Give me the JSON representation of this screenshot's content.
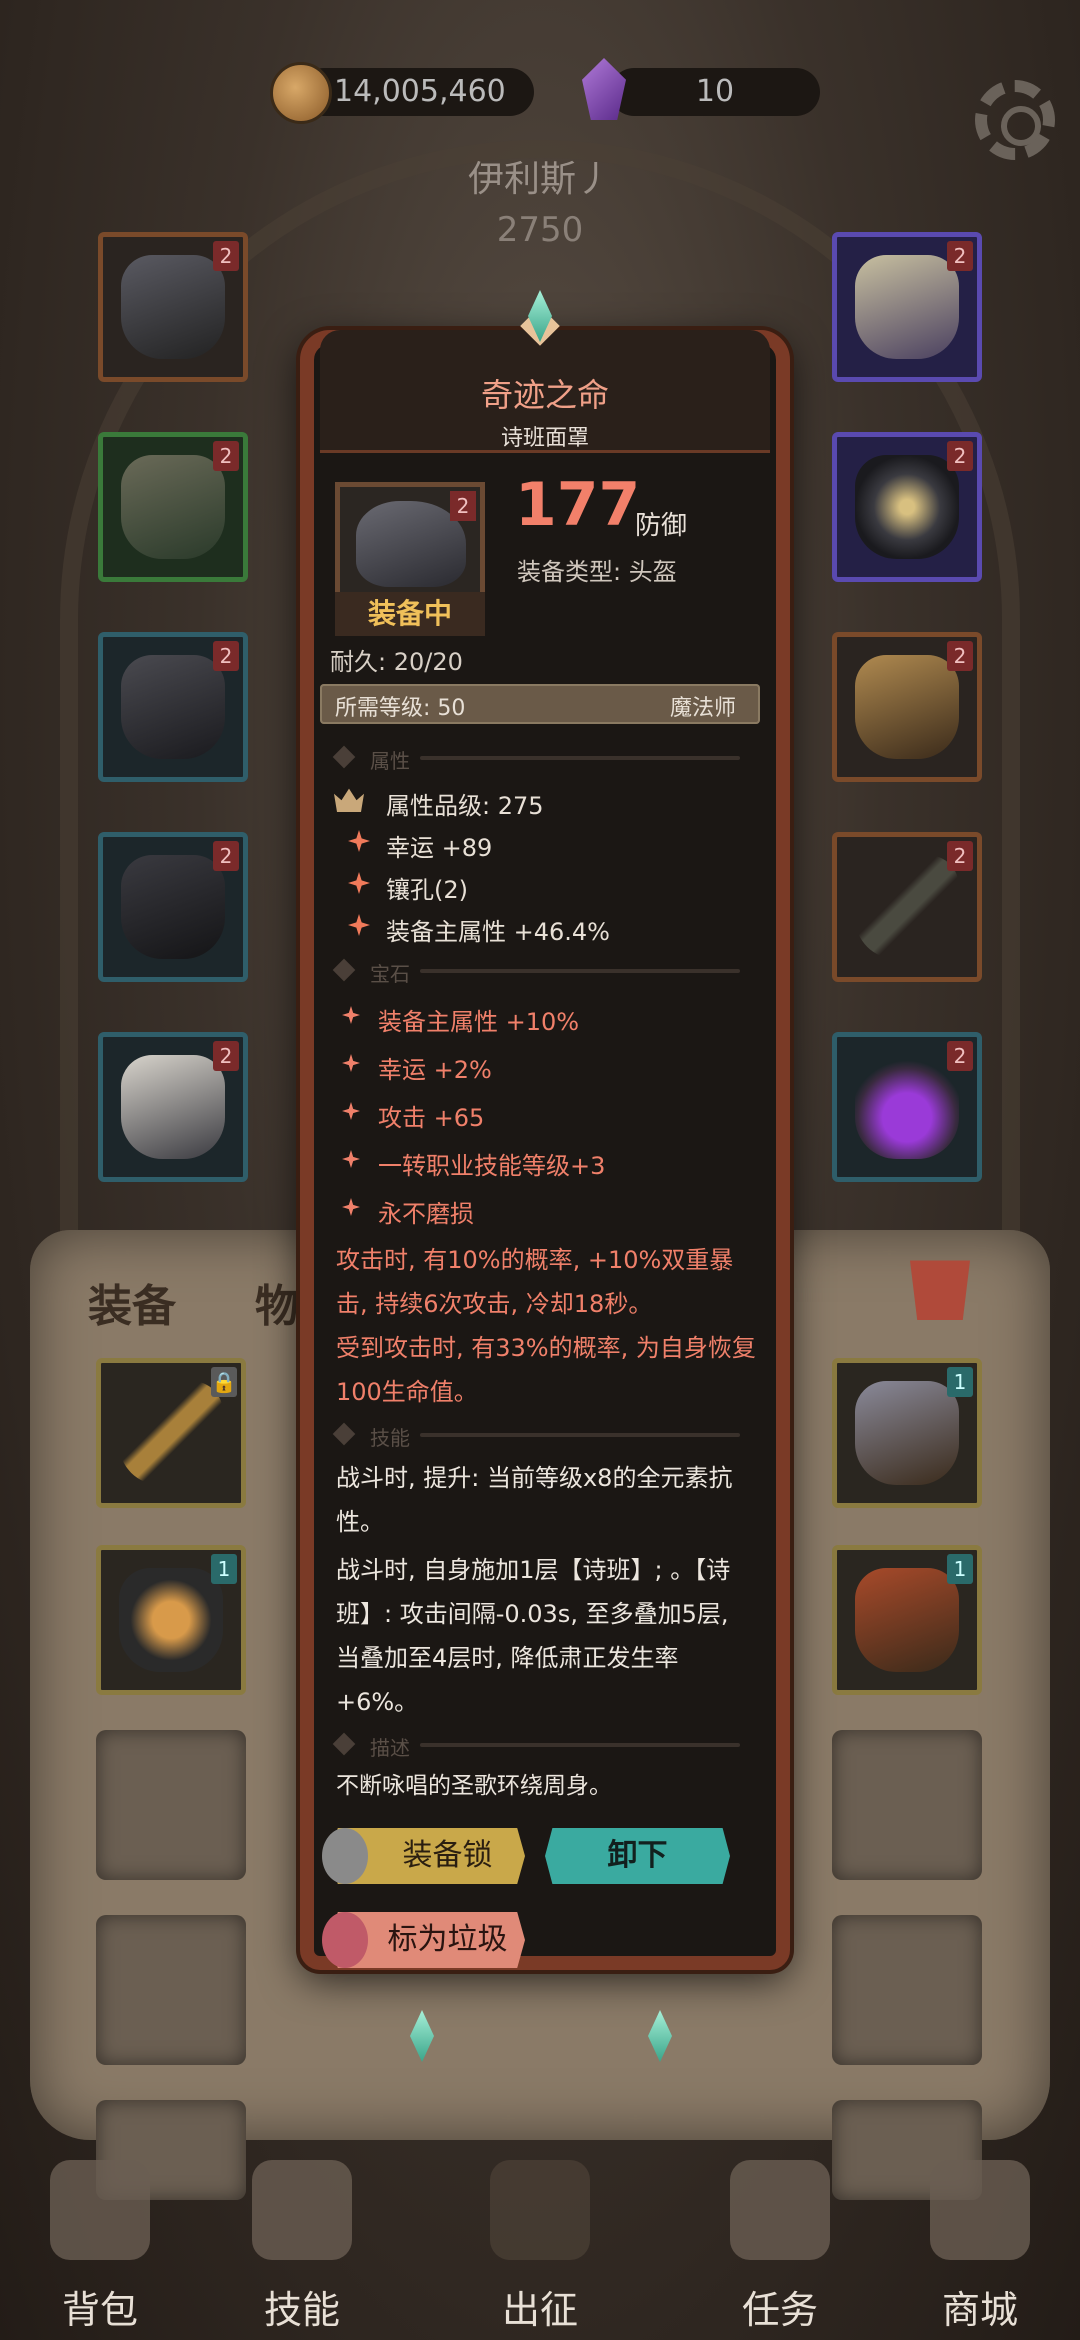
{
  "currency": {
    "gold": "14,005,460",
    "gems": "10"
  },
  "character": {
    "name": "伊利斯丿",
    "power": "2750"
  },
  "tabs": {
    "equip": "装备",
    "items": "物品"
  },
  "nav": [
    {
      "label": "背包",
      "icon": "backpack-icon"
    },
    {
      "label": "技能",
      "icon": "skill-book-icon"
    },
    {
      "label": "出征",
      "icon": "sword-icon"
    },
    {
      "label": "任务",
      "icon": "quest-icon"
    },
    {
      "label": "商城",
      "icon": "shop-icon"
    }
  ],
  "item": {
    "name": "奇迹之命",
    "subname": "诗班面罩",
    "defense_value": "177",
    "defense_label": "防御",
    "type_line": "装备类型: 头盔",
    "equipped": "装备中",
    "durability": "耐久: 20/20",
    "req_level": "所需等级: 50",
    "req_class": "魔法师",
    "sections": {
      "attributes": "属性",
      "gems": "宝石",
      "skills": "技能",
      "description": "描述"
    },
    "attributes": [
      "属性品级: 275",
      "幸运 +89",
      "镶孔(2)",
      "装备主属性 +46.4%"
    ],
    "gem_lines": [
      "装备主属性 +10%",
      "幸运 +2%",
      "攻击 +65",
      "一转职业技能等级+3",
      "永不磨损"
    ],
    "effect_1": "攻击时, 有10%的概率, +10%双重暴击, 持续6次攻击, 冷却18秒。",
    "effect_2": "受到攻击时, 有33%的概率, 为自身恢复100生命值。",
    "skill_1": "战斗时, 提升: 当前等级x8的全元素抗性。",
    "skill_2": "战斗时, 自身施加1层【诗班】; 。【诗班】: 攻击间隔-0.03s, 至多叠加5层, 当叠加至4层时, 降低肃正发生率+6%。",
    "description": "不断咏唱的圣歌环绕周身。"
  },
  "buttons": {
    "lock": "装备锁",
    "unequip": "卸下",
    "junk": "标为垃圾"
  },
  "slot_badge": "2",
  "inventory_badge": "1",
  "colors": {
    "accent_red": "#f0806a",
    "popup_border": "#7a3a26",
    "unequip_btn": "#3aaaa0",
    "lock_btn": "#c9a84a"
  }
}
